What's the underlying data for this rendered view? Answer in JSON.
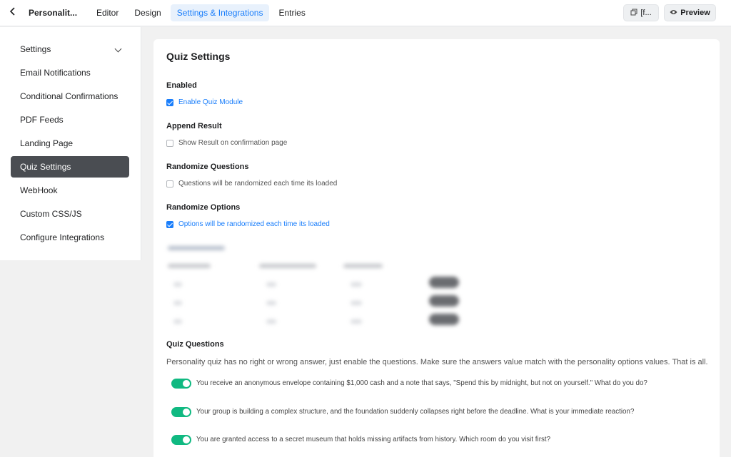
{
  "header": {
    "back_icon": "chevron-left-icon",
    "form_name": "Personalit...",
    "tabs": [
      {
        "label": "Editor",
        "active": false
      },
      {
        "label": "Design",
        "active": false
      },
      {
        "label": "Settings & Integrations",
        "active": true
      },
      {
        "label": "Entries",
        "active": false
      }
    ],
    "copy_button": {
      "icon": "copy-icon",
      "label": "[f..."
    },
    "preview_button": {
      "icon": "eye-icon",
      "label": "Preview"
    }
  },
  "sidebar": {
    "items": [
      {
        "label": "Settings",
        "active": false,
        "expandable": true
      },
      {
        "label": "Email Notifications",
        "active": false
      },
      {
        "label": "Conditional Confirmations",
        "active": false
      },
      {
        "label": "PDF Feeds",
        "active": false
      },
      {
        "label": "Landing Page",
        "active": false
      },
      {
        "label": "Quiz Settings",
        "active": true
      },
      {
        "label": "WebHook",
        "active": false
      },
      {
        "label": "Custom CSS/JS",
        "active": false
      },
      {
        "label": "Configure Integrations",
        "active": false
      }
    ]
  },
  "main": {
    "title": "Quiz Settings",
    "sections": [
      {
        "label": "Enabled",
        "option": "Enable Quiz Module",
        "checked": true
      },
      {
        "label": "Append Result",
        "option": "Show Result on confirmation page",
        "checked": false
      },
      {
        "label": "Randomize Questions",
        "option": "Questions will be randomized each time its loaded",
        "checked": false
      },
      {
        "label": "Randomize Options",
        "option": "Options will be randomized each time its loaded",
        "checked": true
      }
    ],
    "quiz_questions": {
      "label": "Quiz Questions",
      "help": "Personality quiz has no right or wrong answer, just enable the questions. Make sure the answers value match with the personality options values. That is all.",
      "items": [
        {
          "text": "You receive an anonymous envelope containing $1,000 cash and a note that says, \"Spend this by midnight, but not on yourself.\" What do you do?",
          "enabled": true
        },
        {
          "text": "Your group is building a complex structure, and the foundation suddenly collapses right before the deadline. What is your immediate reaction?",
          "enabled": true
        },
        {
          "text": "You are granted access to a secret museum that holds missing artifacts from history. Which room do you visit first?",
          "enabled": true
        }
      ]
    }
  },
  "colors": {
    "accent": "#1a7efb",
    "toggle_on": "#10b981",
    "sidebar_active": "#4a4d52"
  }
}
